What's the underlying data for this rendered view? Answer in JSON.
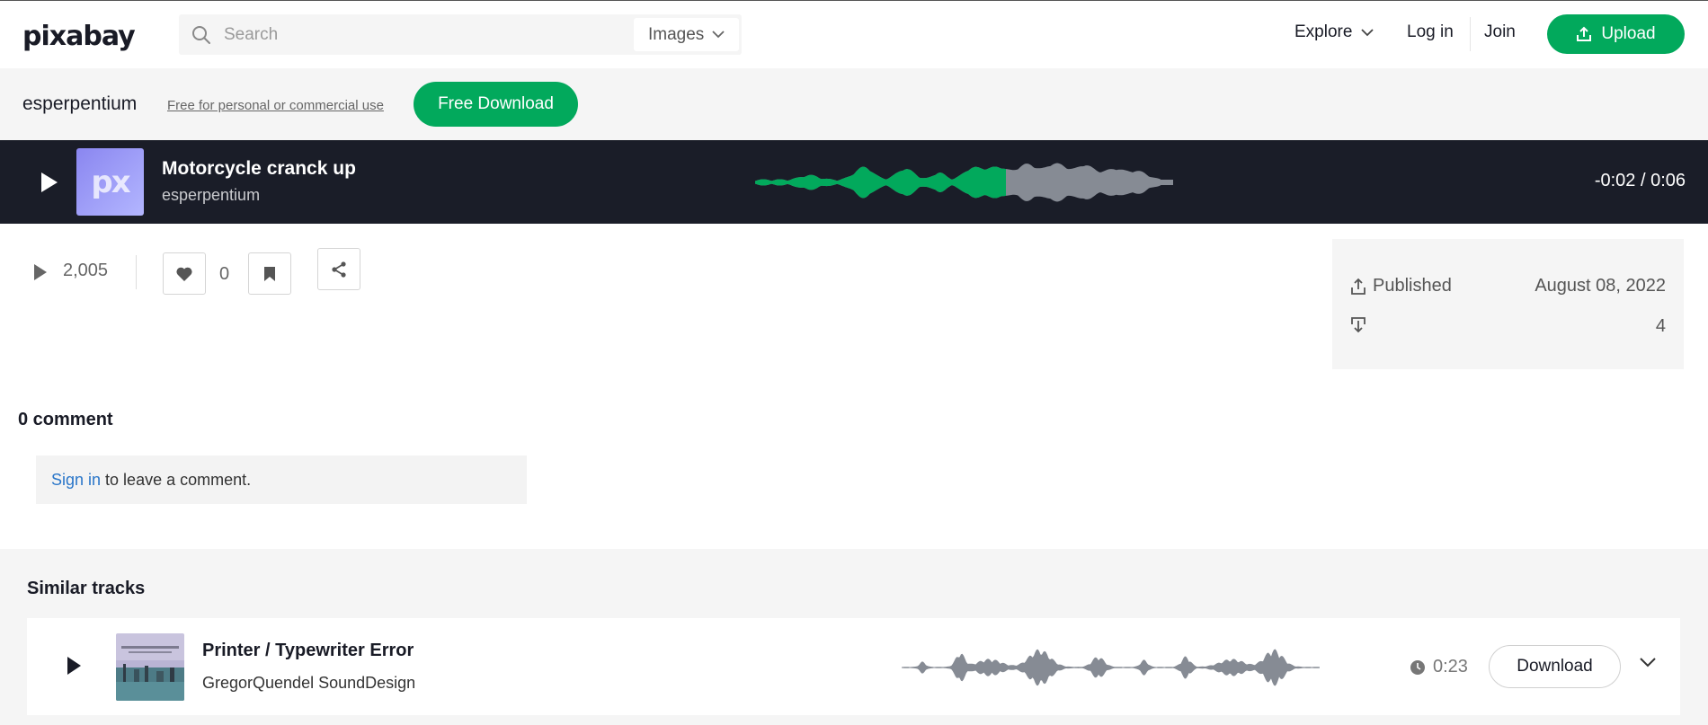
{
  "header": {
    "logo": "pixabay",
    "search_placeholder": "Search",
    "search_type": "Images",
    "nav": {
      "explore": "Explore",
      "login": "Log in",
      "join": "Join",
      "upload": "Upload"
    }
  },
  "author_bar": {
    "author": "esperpentium",
    "license": "Free for personal or commercial use",
    "free_download": "Free Download"
  },
  "player": {
    "thumb_text": "px",
    "title": "Motorcycle cranck up",
    "author": "esperpentium",
    "time": "-0:02 / 0:06",
    "progress": 0.6,
    "played_color": "#02a95c",
    "unplayed_color": "#868b94"
  },
  "stats": {
    "plays": "2,005",
    "likes": "0"
  },
  "info": {
    "published_label": "Published",
    "published_date": "August 08, 2022",
    "downloads": "4"
  },
  "comments": {
    "title": "0 comment",
    "signin_link": "Sign in",
    "signin_text": " to leave a comment."
  },
  "similar": {
    "title": "Similar tracks",
    "tracks": [
      {
        "title": "Printer / Typewriter Error",
        "author": "GregorQuendel SoundDesign",
        "duration": "0:23",
        "download": "Download"
      }
    ]
  },
  "colors": {
    "accent": "#02a95c",
    "player_bg": "#1a1d28",
    "link": "#2a76c9"
  }
}
